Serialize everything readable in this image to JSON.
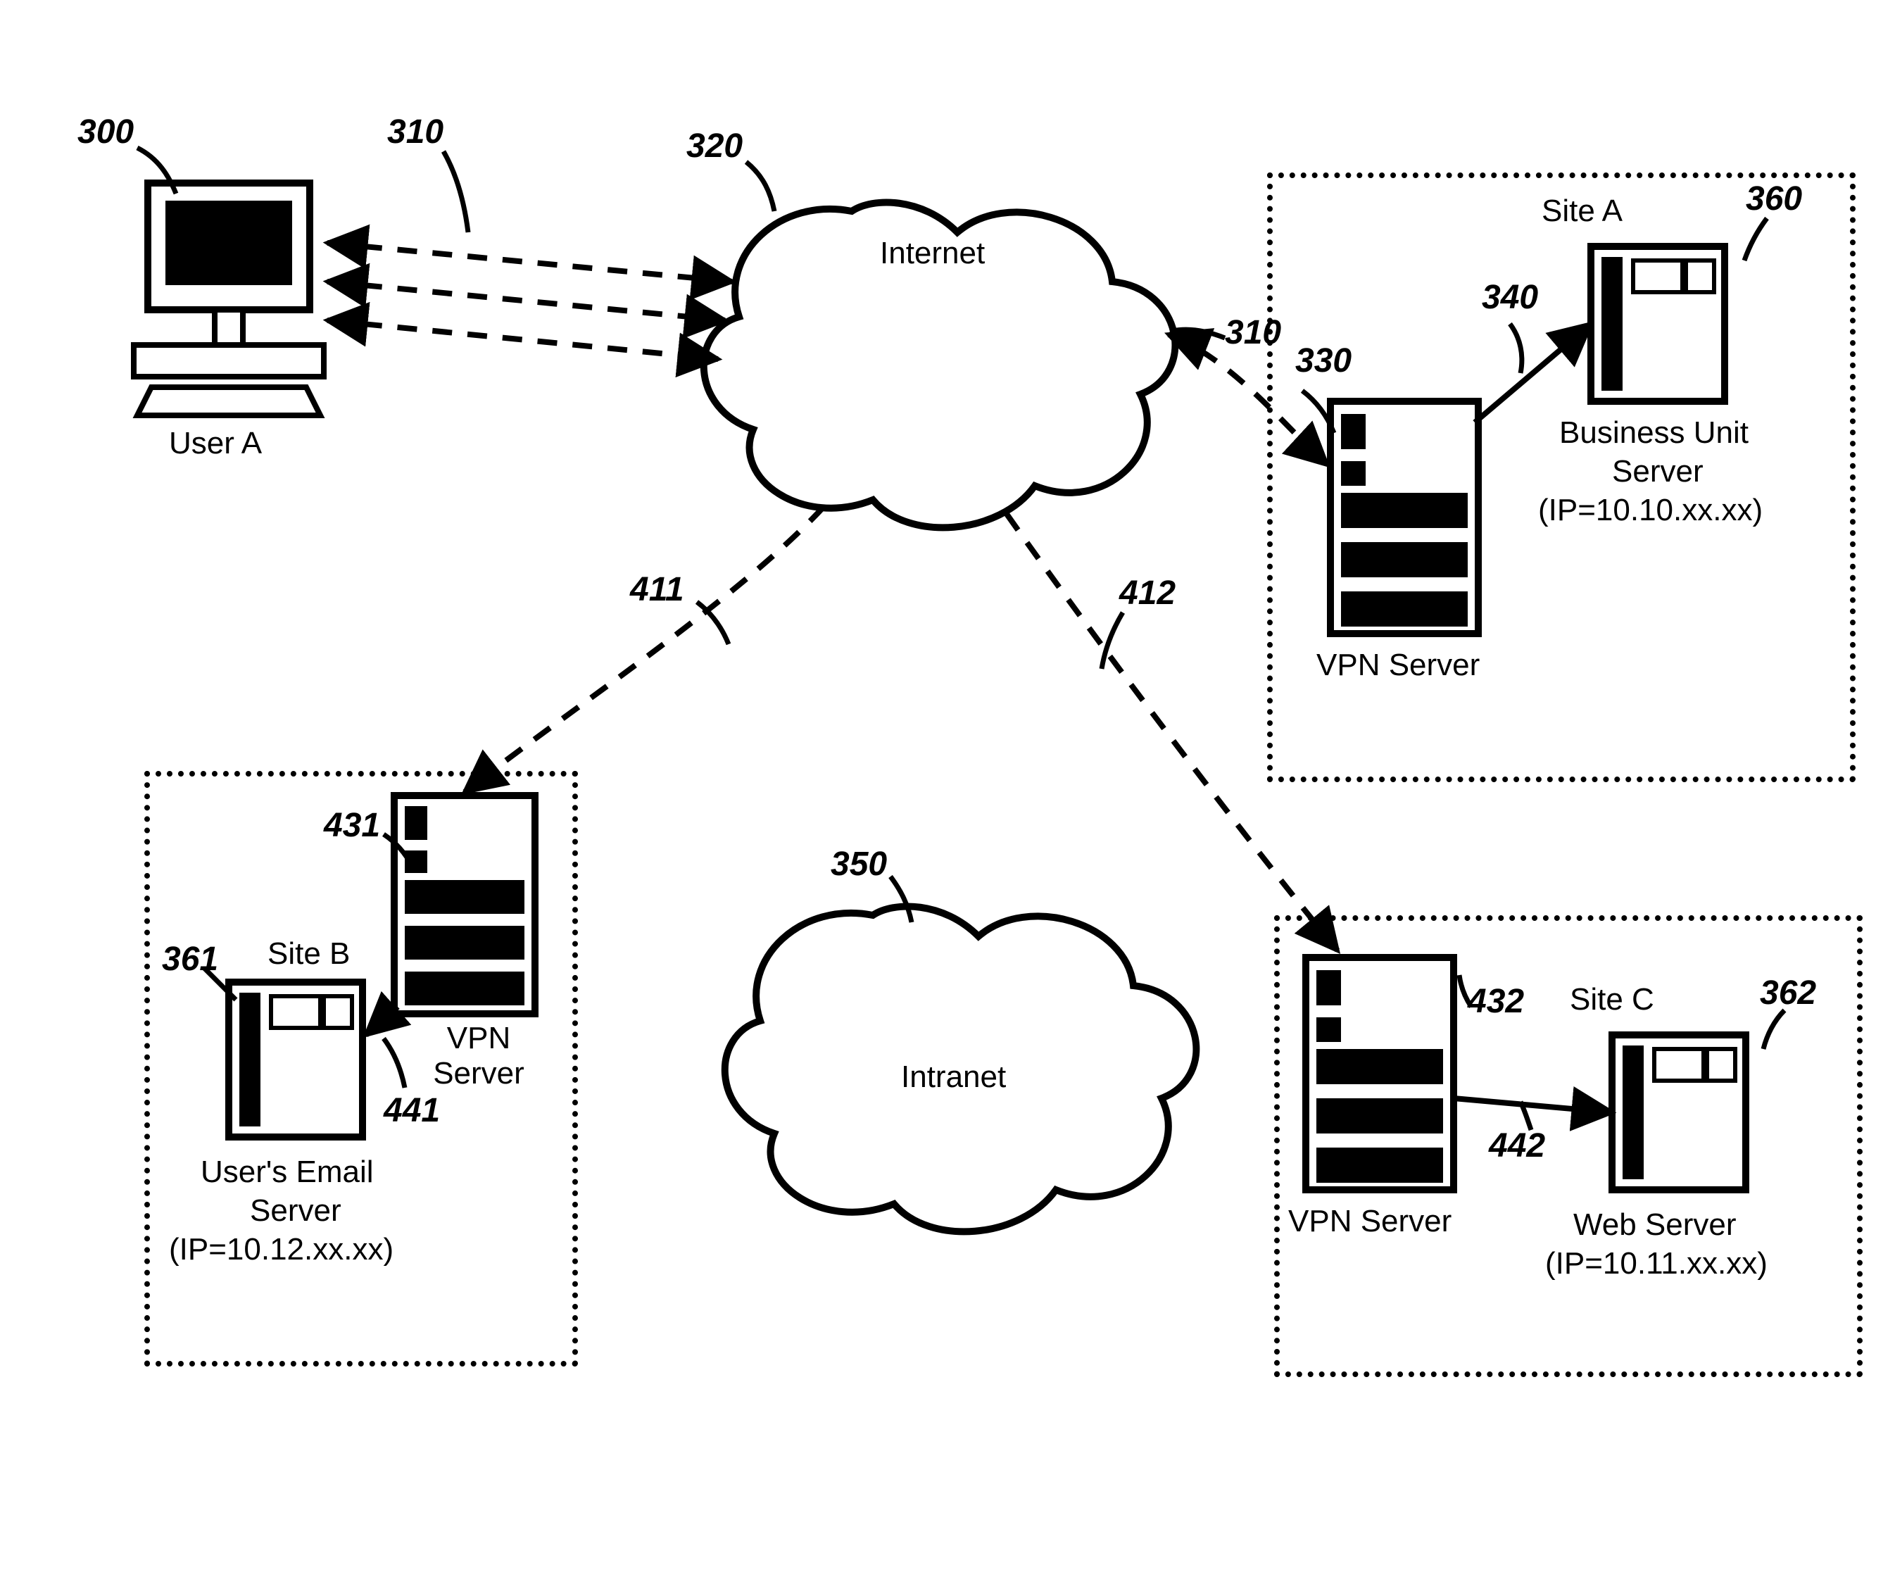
{
  "user": {
    "label": "User A"
  },
  "clouds": {
    "internet": "Internet",
    "intranet": "Intranet"
  },
  "sites": {
    "a": {
      "title": "Site A",
      "vpn": "VPN Server",
      "server_name": "Business Unit",
      "server_sub": "Server",
      "ip": "(IP=10.10.xx.xx)"
    },
    "b": {
      "title": "Site B",
      "vpn": "VPN Server",
      "server_name": "User's Email",
      "server_sub": "Server",
      "ip": "(IP=10.12.xx.xx)"
    },
    "c": {
      "title": "Site C",
      "vpn": "VPN Server",
      "server_name": "Web Server",
      "ip": "(IP=10.11.xx.xx)"
    }
  },
  "refs": {
    "r300": "300",
    "r310a": "310",
    "r310b": "310",
    "r320": "320",
    "r330": "330",
    "r340": "340",
    "r350": "350",
    "r360": "360",
    "r361": "361",
    "r362": "362",
    "r411": "411",
    "r412": "412",
    "r431": "431",
    "r432": "432",
    "r441": "441",
    "r442": "442"
  }
}
